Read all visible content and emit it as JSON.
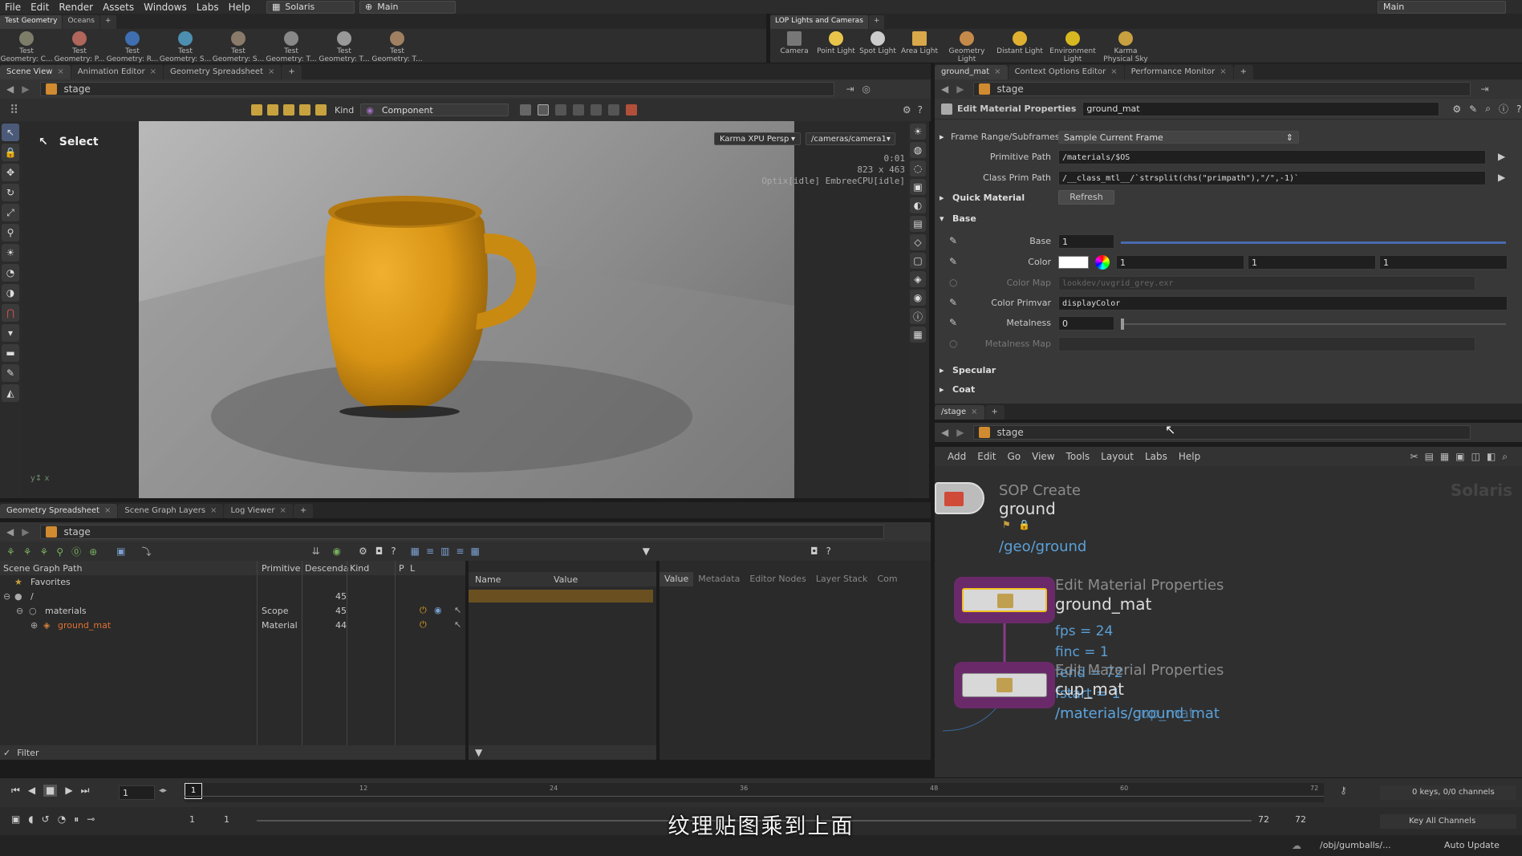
{
  "menubar": {
    "items": [
      "File",
      "Edit",
      "Render",
      "Assets",
      "Windows",
      "Labs",
      "Help"
    ],
    "desktop": "Solaris",
    "context": "Main",
    "right_context": "Main"
  },
  "shelf_left": {
    "tabs": [
      "Test Geometry",
      "Oceans"
    ],
    "tools": [
      "Test Geometry: C...",
      "Test Geometry: P...",
      "Test Geometry: R...",
      "Test Geometry: S...",
      "Test Geometry: S...",
      "Test Geometry: T...",
      "Test Geometry: T...",
      "Test Geometry: T..."
    ]
  },
  "shelf_right": {
    "tabs": [
      "LOP Lights and Cameras"
    ],
    "tools": [
      "Camera",
      "Point Light",
      "Spot Light",
      "Area Light",
      "Geometry Light",
      "Distant Light",
      "Environment Light",
      "Karma Physical Sky"
    ]
  },
  "scene_view": {
    "tabs": [
      "Scene View",
      "Animation Editor",
      "Geometry Spreadsheet"
    ],
    "path": "stage",
    "kind_label": "Kind",
    "kind_value": "Component",
    "select_label": "Select",
    "renderer": "Karma XPU  Persp",
    "camera": "/cameras/camera1",
    "time": "0:01",
    "resolution": "823 x 463",
    "status": "Optix[idle] EmbreeCPU[idle]",
    "axis": "y↕ x"
  },
  "params": {
    "tabs": [
      "ground_mat",
      "Context Options Editor",
      "Performance Monitor"
    ],
    "path": "stage",
    "node_type": "Edit Material Properties",
    "node_name": "ground_mat",
    "frame_range_label": "Frame Range/Subframes",
    "frame_range_value": "Sample Current Frame",
    "primitive_path_label": "Primitive Path",
    "primitive_path_value": "/materials/$OS",
    "class_prim_label": "Class Prim Path",
    "class_prim_value": "/__class_mtl__/`strsplit(chs(\"primpath\"),\"/\",-1)`",
    "quick_material": "Quick Material",
    "refresh": "Refresh",
    "base_folder": "Base",
    "base_label": "Base",
    "base_value": "1",
    "color_label": "Color",
    "color_r": "1",
    "color_g": "1",
    "color_b": "1",
    "colormap_label": "Color Map",
    "colormap_value": "lookdev/uvgrid_grey.exr",
    "colorprimvar_label": "Color Primvar",
    "colorprimvar_value": "displayColor",
    "metalness_label": "Metalness",
    "metalness_value": "0",
    "metalnessmap_label": "Metalness Map",
    "specular": "Specular",
    "coat": "Coat"
  },
  "network": {
    "tab": "/stage",
    "path": "stage",
    "menu": [
      "Add",
      "Edit",
      "Go",
      "View",
      "Tools",
      "Layout",
      "Labs",
      "Help"
    ],
    "watermark": "Solaris",
    "node1": {
      "type": "SOP Create",
      "name": "ground",
      "path": "/geo/ground"
    },
    "node2": {
      "type": "Edit Material Properties",
      "name": "ground_mat",
      "info1": "fps = 24",
      "info2": "finc = 1",
      "info3": "fend = 72",
      "info4": "fstart = 1"
    },
    "node3": {
      "type": "Edit Material Properties",
      "name": "cup_mat",
      "path": "/materials/ground_mat",
      "path_overlap": "/materials/cup_mat"
    }
  },
  "spreadsheet": {
    "tabs": [
      "Geometry Spreadsheet",
      "Scene Graph Layers",
      "Log Viewer"
    ],
    "path": "stage",
    "columns": [
      "Scene Graph Path",
      "Primitive",
      "Descenda",
      "Kind",
      "P",
      "L"
    ],
    "rows": [
      {
        "name": "Favorites",
        "prim": "",
        "desc": "",
        "kind": ""
      },
      {
        "name": "/",
        "prim": "",
        "desc": "45",
        "kind": ""
      },
      {
        "name": "materials",
        "prim": "Scope",
        "desc": "45",
        "kind": ""
      },
      {
        "name": "ground_mat",
        "prim": "Material",
        "desc": "44",
        "kind": ""
      }
    ],
    "mid_columns": [
      "Name",
      "Value"
    ],
    "right_tabs": [
      "Value",
      "Metadata",
      "Editor Nodes",
      "Layer Stack",
      "Com"
    ],
    "filter": "Filter"
  },
  "timeline": {
    "frame": "1",
    "start": "1",
    "start2": "1",
    "end": "72",
    "end2": "72",
    "keys": "0 keys, 0/0 channels",
    "key_all": "Key All Channels",
    "ticks": [
      "1",
      "12",
      "24",
      "36",
      "48",
      "60",
      "72"
    ],
    "status_path": "/obj/gumballs/...",
    "auto_update": "Auto Update"
  },
  "subtitle": "纹理贴图乘到上面"
}
